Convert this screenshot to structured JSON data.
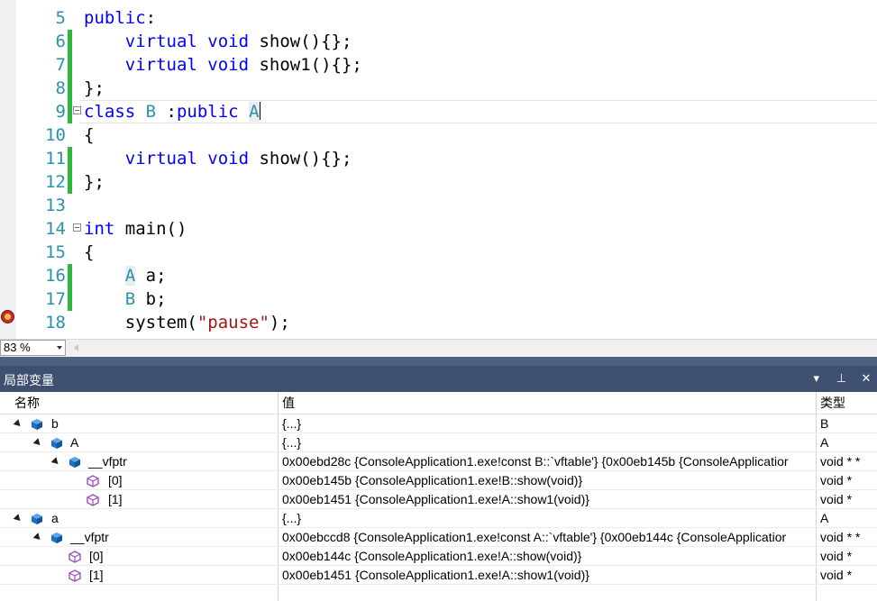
{
  "editor": {
    "lines": [
      {
        "num": "5",
        "tokens": [
          {
            "t": "public",
            "c": "kw"
          },
          {
            "t": ":",
            "c": ""
          }
        ]
      },
      {
        "num": "6",
        "tokens": [
          {
            "t": "    virtual void",
            "c": "kw"
          },
          {
            "t": " show(){};",
            "c": ""
          }
        ]
      },
      {
        "num": "7",
        "tokens": [
          {
            "t": "    virtual void",
            "c": "kw"
          },
          {
            "t": " show1(){};",
            "c": ""
          }
        ]
      },
      {
        "num": "8",
        "tokens": [
          {
            "t": "};",
            "c": ""
          }
        ]
      },
      {
        "num": "9",
        "tokens": [
          {
            "t": "class",
            "c": "kw"
          },
          {
            "t": " B ",
            "c": "ty"
          },
          {
            "t": ":",
            "c": ""
          },
          {
            "t": "public",
            "c": "kw"
          },
          {
            "t": " ",
            "c": ""
          },
          {
            "t": "A",
            "c": "ty hl-box"
          }
        ]
      },
      {
        "num": "10",
        "tokens": [
          {
            "t": "{",
            "c": ""
          }
        ]
      },
      {
        "num": "11",
        "tokens": [
          {
            "t": "    virtual void",
            "c": "kw"
          },
          {
            "t": " show(){};",
            "c": ""
          }
        ]
      },
      {
        "num": "12",
        "tokens": [
          {
            "t": "};",
            "c": ""
          }
        ]
      },
      {
        "num": "13",
        "tokens": []
      },
      {
        "num": "14",
        "tokens": [
          {
            "t": "int",
            "c": "kw"
          },
          {
            "t": " main()",
            "c": ""
          }
        ]
      },
      {
        "num": "15",
        "tokens": [
          {
            "t": "{",
            "c": ""
          }
        ]
      },
      {
        "num": "16",
        "tokens": [
          {
            "t": "    ",
            "c": ""
          },
          {
            "t": "A",
            "c": "ty hl-box"
          },
          {
            "t": " a;",
            "c": ""
          }
        ]
      },
      {
        "num": "17",
        "tokens": [
          {
            "t": "    ",
            "c": ""
          },
          {
            "t": "B",
            "c": "ty"
          },
          {
            "t": " b;",
            "c": ""
          }
        ]
      },
      {
        "num": "18",
        "tokens": [
          {
            "t": "    system(",
            "c": ""
          },
          {
            "t": "\"pause\"",
            "c": "str"
          },
          {
            "t": ");",
            "c": ""
          }
        ]
      }
    ]
  },
  "status": {
    "zoom": "83 %"
  },
  "locals": {
    "title": "局部变量",
    "columns": {
      "name": "名称",
      "value": "值",
      "type": "类型"
    },
    "rows": [
      {
        "name": "b",
        "value": "{...}",
        "type": "B"
      },
      {
        "name": "A",
        "value": "{...}",
        "type": "A"
      },
      {
        "name": "__vfptr",
        "value": "0x00ebd28c {ConsoleApplication1.exe!const B::`vftable'} {0x00eb145b {ConsoleApplicatior",
        "type": "void * *"
      },
      {
        "name": "[0]",
        "value": "0x00eb145b {ConsoleApplication1.exe!B::show(void)}",
        "type": "void *"
      },
      {
        "name": "[1]",
        "value": "0x00eb1451 {ConsoleApplication1.exe!A::show1(void)}",
        "type": "void *"
      },
      {
        "name": "a",
        "value": "{...}",
        "type": "A"
      },
      {
        "name": "__vfptr",
        "value": "0x00ebccd8 {ConsoleApplication1.exe!const A::`vftable'} {0x00eb144c {ConsoleApplicatior",
        "type": "void * *"
      },
      {
        "name": "[0]",
        "value": "0x00eb144c {ConsoleApplication1.exe!A::show(void)}",
        "type": "void *"
      },
      {
        "name": "[1]",
        "value": "0x00eb1451 {ConsoleApplication1.exe!A::show1(void)}",
        "type": "void *"
      }
    ]
  },
  "colors": {
    "keyword": "#0000ff",
    "type": "#2b91af",
    "string": "#a31515",
    "change_bar": "#2db83d",
    "panel_header": "#3e4f6f"
  }
}
